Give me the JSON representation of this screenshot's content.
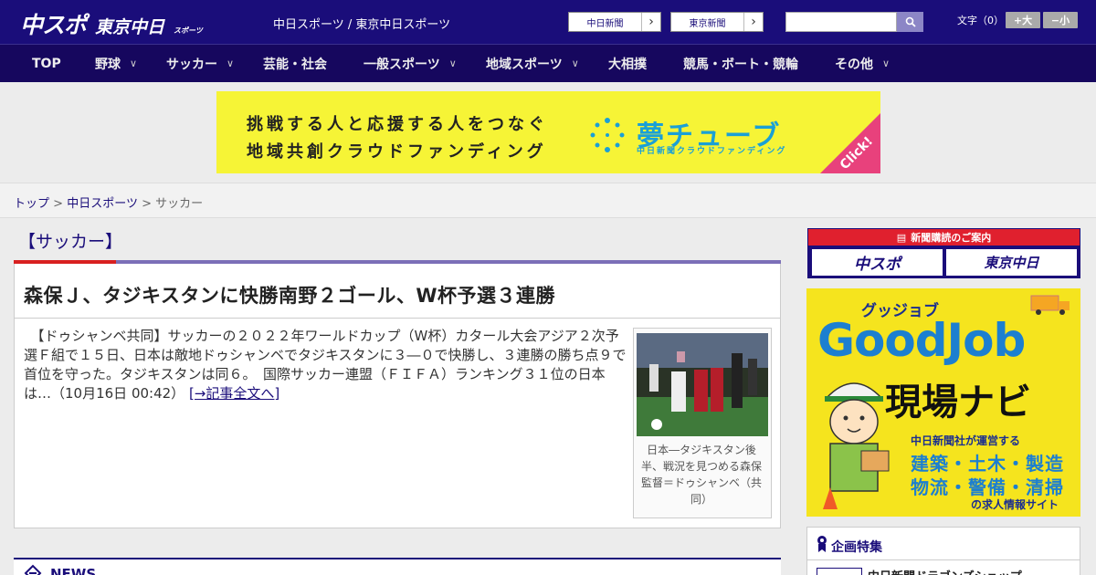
{
  "header": {
    "logo_main": "中スポ",
    "logo_sub": "東京中日",
    "logo_small": "スポーツ",
    "tagline": "中日スポーツ / 東京中日スポーツ",
    "paper_links": [
      {
        "label": "中日新聞"
      },
      {
        "label": "東京新聞"
      }
    ],
    "search_placeholder": "",
    "fontsize_label": "文字（0）",
    "fontsize_larger": "+大",
    "fontsize_smaller": "−小"
  },
  "nav": {
    "items": [
      {
        "label": "TOP",
        "has_menu": false
      },
      {
        "label": "野球",
        "has_menu": true
      },
      {
        "label": "サッカー",
        "has_menu": true
      },
      {
        "label": "芸能・社会",
        "has_menu": false
      },
      {
        "label": "一般スポーツ",
        "has_menu": true
      },
      {
        "label": "地域スポーツ",
        "has_menu": true
      },
      {
        "label": "大相撲",
        "has_menu": false
      },
      {
        "label": "競馬・ボート・競輪",
        "has_menu": false
      },
      {
        "label": "その他",
        "has_menu": true
      }
    ],
    "chevron": "∨"
  },
  "banner": {
    "line1": "挑戦する人と応援する人をつなぐ",
    "line2": "地域共創クラウドファンディング",
    "brand": "夢チューブ",
    "brand_sub": "中日新聞クラウドファンディング",
    "click": "Click!"
  },
  "breadcrumb": {
    "home": "トップ",
    "section": "中日スポーツ",
    "current": "サッカー",
    "sep": ">"
  },
  "main": {
    "section_title": "【サッカー】",
    "headline": "森保Ｊ、タジキスタンに快勝南野２ゴール、W杯予選３連勝",
    "body": "　【ドゥシャンベ共同】サッカーの２０２２年ワールドカップ（W杯）カタール大会アジア２次予選Ｆ組で１５日、日本は敵地ドゥシャンベでタジキスタンに３―０で快勝し、３連勝の勝ち点９で首位を守った。タジキスタンは同６。　国際サッカー連盟（ＦＩＦＡ）ランキング３１位の日本は…（10月16日 00:42）",
    "more_link": "[→記事全文へ]",
    "photo_caption": "日本―タジキスタン後半、戦況を見つめる森保監督＝ドゥシャンベ（共同）",
    "news_title": "NEWS"
  },
  "sidebar": {
    "subscribe_head": "新聞購読のご案内",
    "subscribe_btn1": "中スポ",
    "subscribe_btn2": "東京中日",
    "goodjob_small": "グッジョブ",
    "goodjob_big": "GoodJob",
    "goodjob_navi": "現場ナビ",
    "goodjob_l1": "中日新聞社が運営する",
    "goodjob_l2": "建築・土木・製造",
    "goodjob_l3": "物流・警備・清掃",
    "goodjob_l4": "の求人情報サイト",
    "feature_title": "企画特集",
    "feature_item": "中日新聞ドラゴンズショップ"
  },
  "colors": {
    "brand": "#1a0d7a",
    "accent_red": "#d82020",
    "banner_yellow": "#f6f436",
    "goodjob_yellow": "#f5e41e"
  }
}
